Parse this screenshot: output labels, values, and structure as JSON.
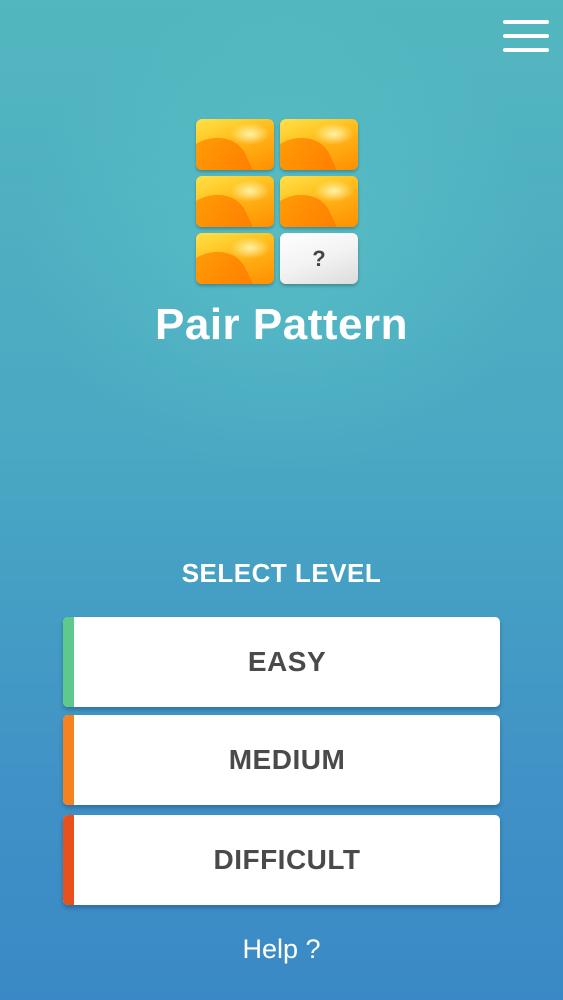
{
  "menu": {
    "icon": "hamburger-menu-icon"
  },
  "logo": {
    "mystery_tile_glyph": "?"
  },
  "app_title": "Pair Pattern",
  "level_select": {
    "heading": "SELECT LEVEL",
    "levels": [
      {
        "label": "EASY",
        "accent_color": "#5dc98a"
      },
      {
        "label": "MEDIUM",
        "accent_color": "#f5821f"
      },
      {
        "label": "DIFFICULT",
        "accent_color": "#e8501c"
      }
    ]
  },
  "help": {
    "label": "Help ?"
  },
  "colors": {
    "background_top": "#53b7bf",
    "background_bottom": "#3a89c6",
    "tile_orange": "#ff9800",
    "tile_yellow": "#ffe14a",
    "button_text": "#4a4a4a"
  }
}
